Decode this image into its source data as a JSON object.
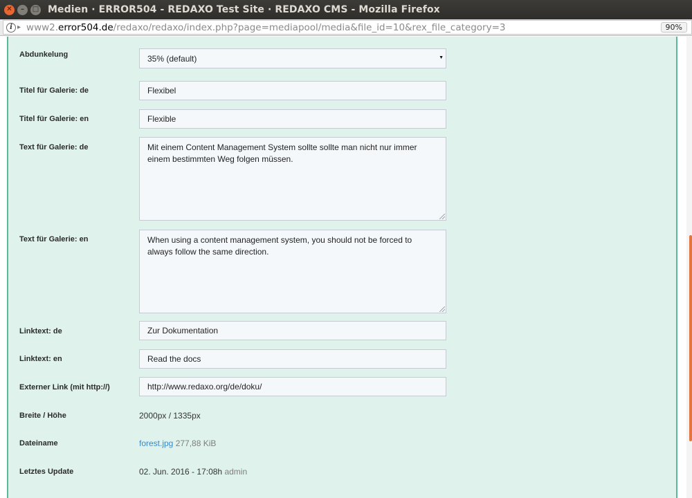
{
  "window": {
    "title": "Medien · ERROR504 - REDAXO Test Site · REDAXO CMS - Mozilla Firefox"
  },
  "urlbar": {
    "url_prefix": "www2.",
    "url_host": "error504.de",
    "url_path": "/redaxo/redaxo/index.php?page=mediapool/media&file_id=10&rex_file_category=3",
    "zoom": "90%"
  },
  "form": {
    "abdunkelung": {
      "label": "Abdunkelung",
      "value": "35% (default)"
    },
    "titel_de": {
      "label": "Titel für Galerie: de",
      "value": "Flexibel"
    },
    "titel_en": {
      "label": "Titel für Galerie: en",
      "value": "Flexible"
    },
    "text_de": {
      "label": "Text für Galerie: de",
      "value": "Mit einem Content Management System sollte sollte man nicht nur immer einem bestimmten Weg folgen müssen."
    },
    "text_en": {
      "label": "Text für Galerie: en",
      "value": "When using a content management system, you should not be forced to always follow the same direction."
    },
    "linktext_de": {
      "label": "Linktext: de",
      "value": "Zur Dokumentation"
    },
    "linktext_en": {
      "label": "Linktext: en",
      "value": "Read the docs"
    },
    "externer_link": {
      "label": "Externer Link (mit http://)",
      "value": "http://www.redaxo.org/de/doku/"
    }
  },
  "info": {
    "breite_hoehe": {
      "label": "Breite / Höhe",
      "value": "2000px / 1335px"
    },
    "dateiname": {
      "label": "Dateiname",
      "filename": "forest.jpg",
      "size": "277,88 KiB"
    },
    "letztes_update": {
      "label": "Letztes Update",
      "date": "02. Jun. 2016 - 17:08h",
      "user": "admin"
    }
  }
}
